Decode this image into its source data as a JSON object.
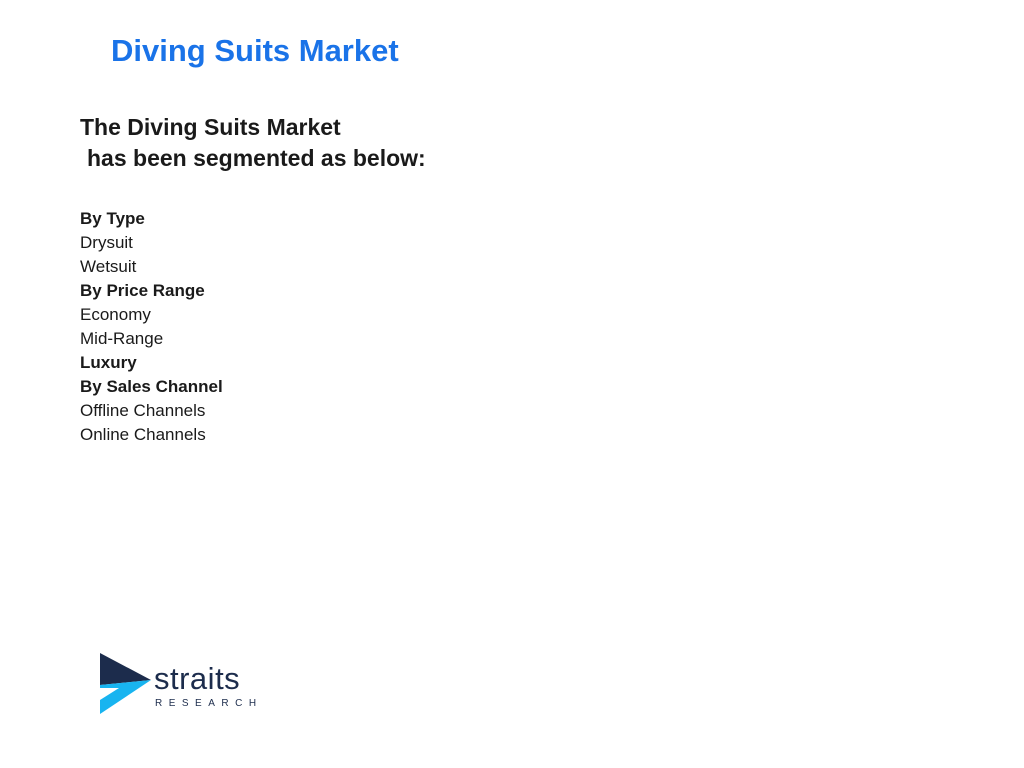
{
  "slide": {
    "title": "Diving Suits Market",
    "subtitle_line1": "The Diving Suits Market",
    "subtitle_line2": "has been segmented as below:"
  },
  "segments": [
    {
      "text": "By Type",
      "bold": true
    },
    {
      "text": "Drysuit",
      "bold": false
    },
    {
      "text": "Wetsuit",
      "bold": false
    },
    {
      "text": "By Price Range",
      "bold": true
    },
    {
      "text": "Economy",
      "bold": false
    },
    {
      "text": "Mid-Range",
      "bold": false
    },
    {
      "text": "Luxury",
      "bold": true
    },
    {
      "text": "By Sales Channel",
      "bold": true
    },
    {
      "text": "Offline Channels",
      "bold": false
    },
    {
      "text": "Online Channels",
      "bold": false
    }
  ],
  "logo": {
    "word": "straits",
    "sub": "RESEARCH",
    "icon": "straits-chevron-logo-icon",
    "colors": {
      "navy": "#1c2c4c",
      "cyan": "#18b4f0"
    }
  },
  "colors": {
    "title": "#1a73e8",
    "text": "#1a1a1a",
    "background": "#ffffff"
  }
}
